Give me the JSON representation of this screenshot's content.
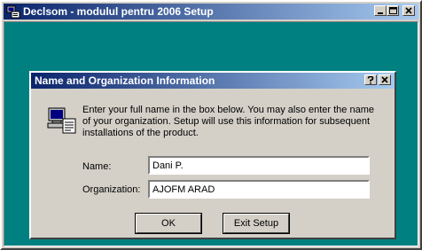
{
  "window": {
    "title": "Declsom - modulul pentru 2006 Setup",
    "icons": {
      "app": "setup-icon",
      "minimize": "minimize-icon",
      "maximize": "maximize-icon",
      "close": "close-icon"
    }
  },
  "dialog": {
    "title": "Name and Organization Information",
    "icons": {
      "help": "help-icon",
      "close": "close-icon",
      "intro": "computer-setup-icon"
    },
    "intro": "Enter your full name in the box below. You may also enter the name of your organization. Setup will use this information for subsequent installations of the product.",
    "fields": {
      "name": {
        "label": "Name:",
        "value": "Dani P."
      },
      "organization": {
        "label": "Organization:",
        "value": "AJOFM ARAD"
      }
    },
    "buttons": {
      "ok": "OK",
      "exit": "Exit Setup"
    }
  },
  "colors": {
    "titlebar_start": "#0a246a",
    "titlebar_end": "#a6caf0",
    "desktop": "#008080",
    "face": "#d4d0c8"
  }
}
